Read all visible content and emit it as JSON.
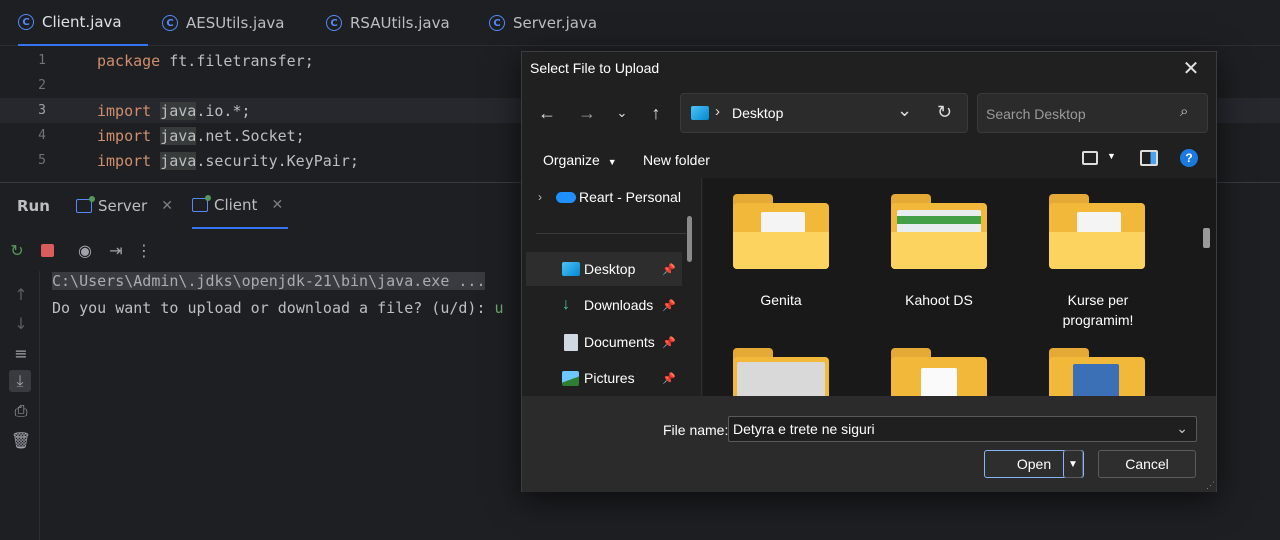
{
  "editor_tabs": [
    {
      "label": "Client.java",
      "icon": "c-class-icon",
      "active": true
    },
    {
      "label": "AESUtils.java",
      "icon": "c-class-icon",
      "active": false
    },
    {
      "label": "RSAUtils.java",
      "icon": "c-class-icon",
      "active": false
    },
    {
      "label": "Server.java",
      "icon": "c-class-icon",
      "active": false
    }
  ],
  "code_lines": [
    {
      "num": "1",
      "kw": "package",
      "rest": " ft.filetransfer;"
    },
    {
      "num": "2",
      "kw": "",
      "rest": ""
    },
    {
      "num": "3",
      "kw": "import",
      "rest": "java",
      "rest2": ".io.*;"
    },
    {
      "num": "4",
      "kw": "import",
      "rest": "java",
      "rest2": ".net.Socket;"
    },
    {
      "num": "5",
      "kw": "import",
      "rest": "java",
      "rest2": ".security.KeyPair;"
    }
  ],
  "run_panel": {
    "title": "Run",
    "tabs": [
      {
        "label": "Server"
      },
      {
        "label": "Client"
      }
    ],
    "console_lines": [
      "C:\\Users\\Admin\\.jdks\\openjdk-21\\bin\\java.exe ...",
      "Do you want to upload or download a file? (u/d): "
    ],
    "user_input": "u"
  },
  "dialog": {
    "title": "Select File to Upload",
    "address": "Desktop",
    "search_placeholder": "Search Desktop",
    "organize_label": "Organize",
    "new_folder_label": "New folder",
    "nav": {
      "cloud_item": "Reart - Personal",
      "items": [
        {
          "label": "Desktop",
          "icon": "desktop-icon"
        },
        {
          "label": "Downloads",
          "icon": "download-icon"
        },
        {
          "label": "Documents",
          "icon": "documents-icon"
        },
        {
          "label": "Pictures",
          "icon": "pictures-icon"
        }
      ]
    },
    "folders": [
      {
        "label": "Genita"
      },
      {
        "label": "Kahoot DS"
      },
      {
        "label": "Kurse per programim!"
      }
    ],
    "file_name_label": "File name:",
    "file_name_value": "Detyra e trete ne siguri",
    "open_label": "Open",
    "cancel_label": "Cancel"
  },
  "colors": {
    "accent": "#3574f0",
    "keyword": "#cf8e6d",
    "user_input": "#6aab73",
    "folder": "#f1b83a"
  }
}
